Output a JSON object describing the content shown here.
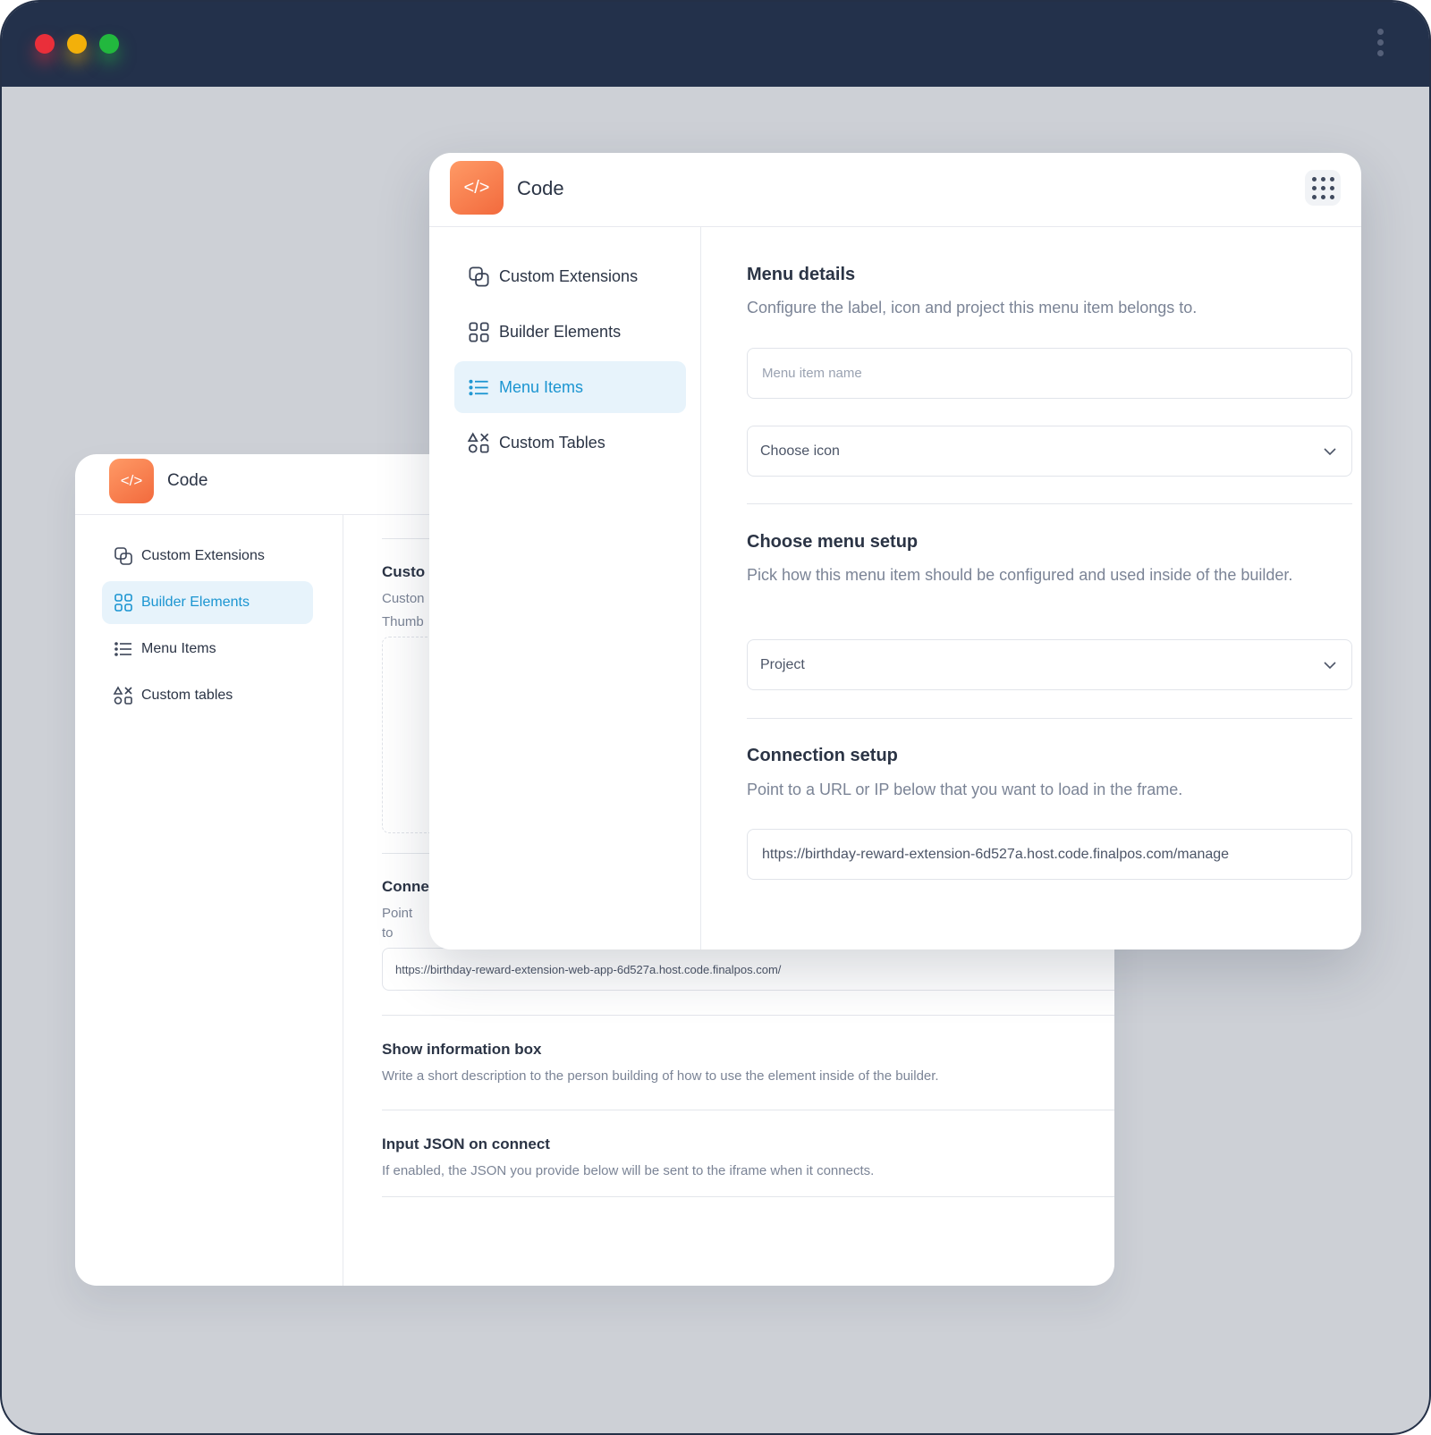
{
  "app": {
    "name": "Code",
    "logo_glyph": "</>"
  },
  "colors": {
    "accent": "#1b95d1",
    "brand": "#f26a3d",
    "titlebar": "#23314b"
  },
  "back_window": {
    "sidebar": [
      {
        "label": "Custom Extensions",
        "icon": "extensions-icon"
      },
      {
        "label": "Builder Elements",
        "icon": "grid-icon",
        "active": true
      },
      {
        "label": "Menu Items",
        "icon": "list-icon"
      },
      {
        "label": "Custom tables",
        "icon": "shapes-icon"
      }
    ],
    "section_custom": {
      "title": "Custo",
      "desc1": "Custon",
      "desc2": "Thumb"
    },
    "section_connection": {
      "title": "Conne",
      "desc": "Point to"
    },
    "url_value": "https://birthday-reward-extension-web-app-6d527a.host.code.finalpos.com/",
    "info_box": {
      "title": "Show information box",
      "desc": "Write a short description to the person building of how to use the element inside of the builder."
    },
    "json_connect": {
      "title": "Input JSON on connect",
      "desc": "If enabled, the JSON you provide below will be sent to the iframe when it connects."
    }
  },
  "front_window": {
    "sidebar": [
      {
        "label": "Custom Extensions",
        "icon": "extensions-icon"
      },
      {
        "label": "Builder Elements",
        "icon": "grid-icon"
      },
      {
        "label": "Menu Items",
        "icon": "list-icon",
        "active": true
      },
      {
        "label": "Custom Tables",
        "icon": "shapes-icon"
      }
    ],
    "menu_details": {
      "title": "Menu details",
      "desc": "Configure the label, icon and project this menu item belongs to.",
      "name_placeholder": "Menu item name",
      "icon_select": "Choose icon"
    },
    "menu_setup": {
      "title": "Choose menu setup",
      "desc": "Pick how this menu item should be configured and used inside of the builder.",
      "select_value": "Project"
    },
    "connection": {
      "title": "Connection setup",
      "desc": "Point to a URL or IP below that you want to load in the frame.",
      "url_value": "https://birthday-reward-extension-6d527a.host.code.finalpos.com/manage"
    }
  }
}
